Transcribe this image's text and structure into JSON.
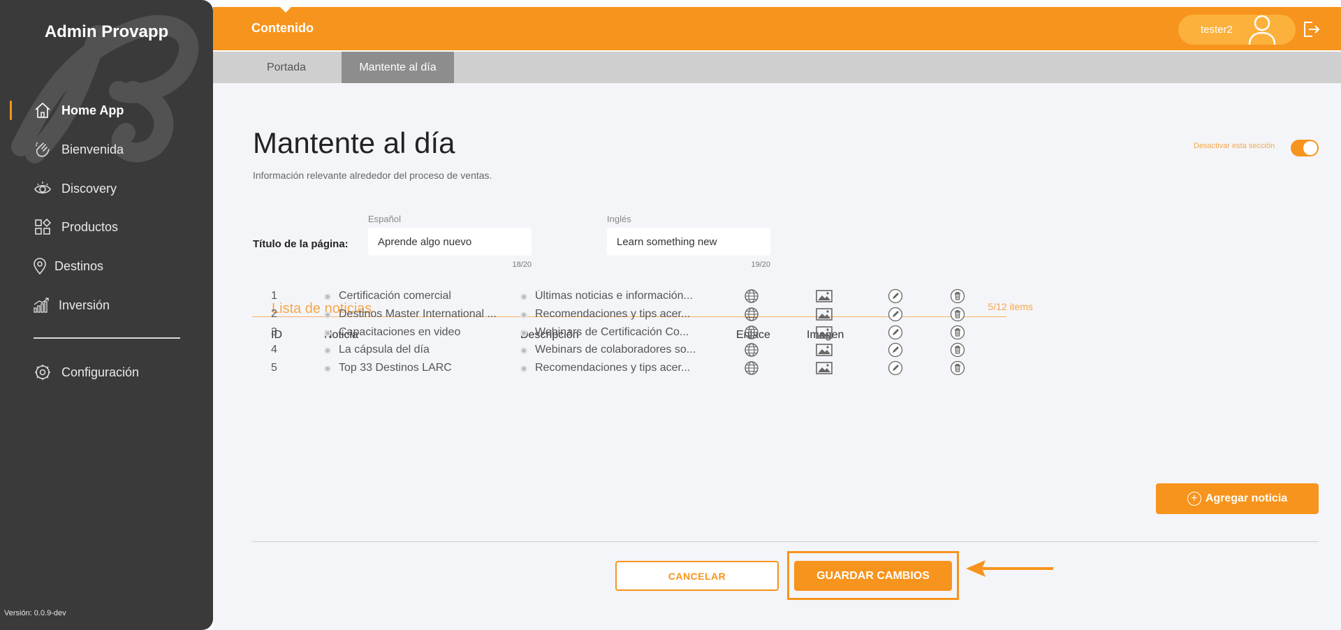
{
  "app": {
    "title": "Admin Provapp",
    "version": "Versión: 0.0.9-dev"
  },
  "sidebar": {
    "items": [
      {
        "label": "Home App",
        "icon": "home-icon",
        "active": true
      },
      {
        "label": "Bienvenida",
        "icon": "wave-hand-icon",
        "active": false
      },
      {
        "label": "Discovery",
        "icon": "eye-icon",
        "active": false
      },
      {
        "label": "Productos",
        "icon": "grid-icon",
        "active": false
      },
      {
        "label": "Destinos",
        "icon": "location-pin-icon",
        "active": false
      },
      {
        "label": "Inversión",
        "icon": "bar-chart-icon",
        "active": false
      }
    ],
    "settings": {
      "label": "Configuración",
      "icon": "gear-icon"
    }
  },
  "header": {
    "section": "Contenido",
    "user": "tester2",
    "colors": {
      "accent": "#f7941d",
      "pill": "#fbb13c",
      "sidebar": "#3a3a3a"
    }
  },
  "tabs": [
    {
      "label": "Portada",
      "active": false
    },
    {
      "label": "Mantente al día",
      "active": true
    }
  ],
  "page": {
    "title": "Mantente al día",
    "subtitle": "Información relevante alrededor del proceso de ventas.",
    "toggle_label": "Desactivar esta sección",
    "toggle_on": true
  },
  "form": {
    "field_label": "Título de la página:",
    "spanish": {
      "label": "Español",
      "value": "Aprende algo nuevo",
      "counter": "18/20"
    },
    "english": {
      "label": "Inglés",
      "value": "Learn something new",
      "counter": "19/20"
    }
  },
  "news": {
    "title": "Lista de noticias",
    "count": "5/12 items",
    "columns": {
      "id": "ID",
      "title": "Noticia",
      "desc": "Descripción",
      "link": "Enlace",
      "image": "Imagen"
    },
    "rows": [
      {
        "id": "1",
        "title": "Certificación comercial",
        "desc": "Últimas noticias e información..."
      },
      {
        "id": "2",
        "title": "Destinos Master International ...",
        "desc": "Recomendaciones y tips acer..."
      },
      {
        "id": "3",
        "title": "Capacitaciones en video",
        "desc": "Webinars de Certificación Co..."
      },
      {
        "id": "4",
        "title": "La cápsula del día",
        "desc": "Webinars de colaboradores so..."
      },
      {
        "id": "5",
        "title": "Top 33 Destinos LARC",
        "desc": "Recomendaciones y tips acer..."
      }
    ]
  },
  "actions": {
    "add": "Agregar noticia",
    "cancel": "CANCELAR",
    "save": "GUARDAR CAMBIOS"
  }
}
